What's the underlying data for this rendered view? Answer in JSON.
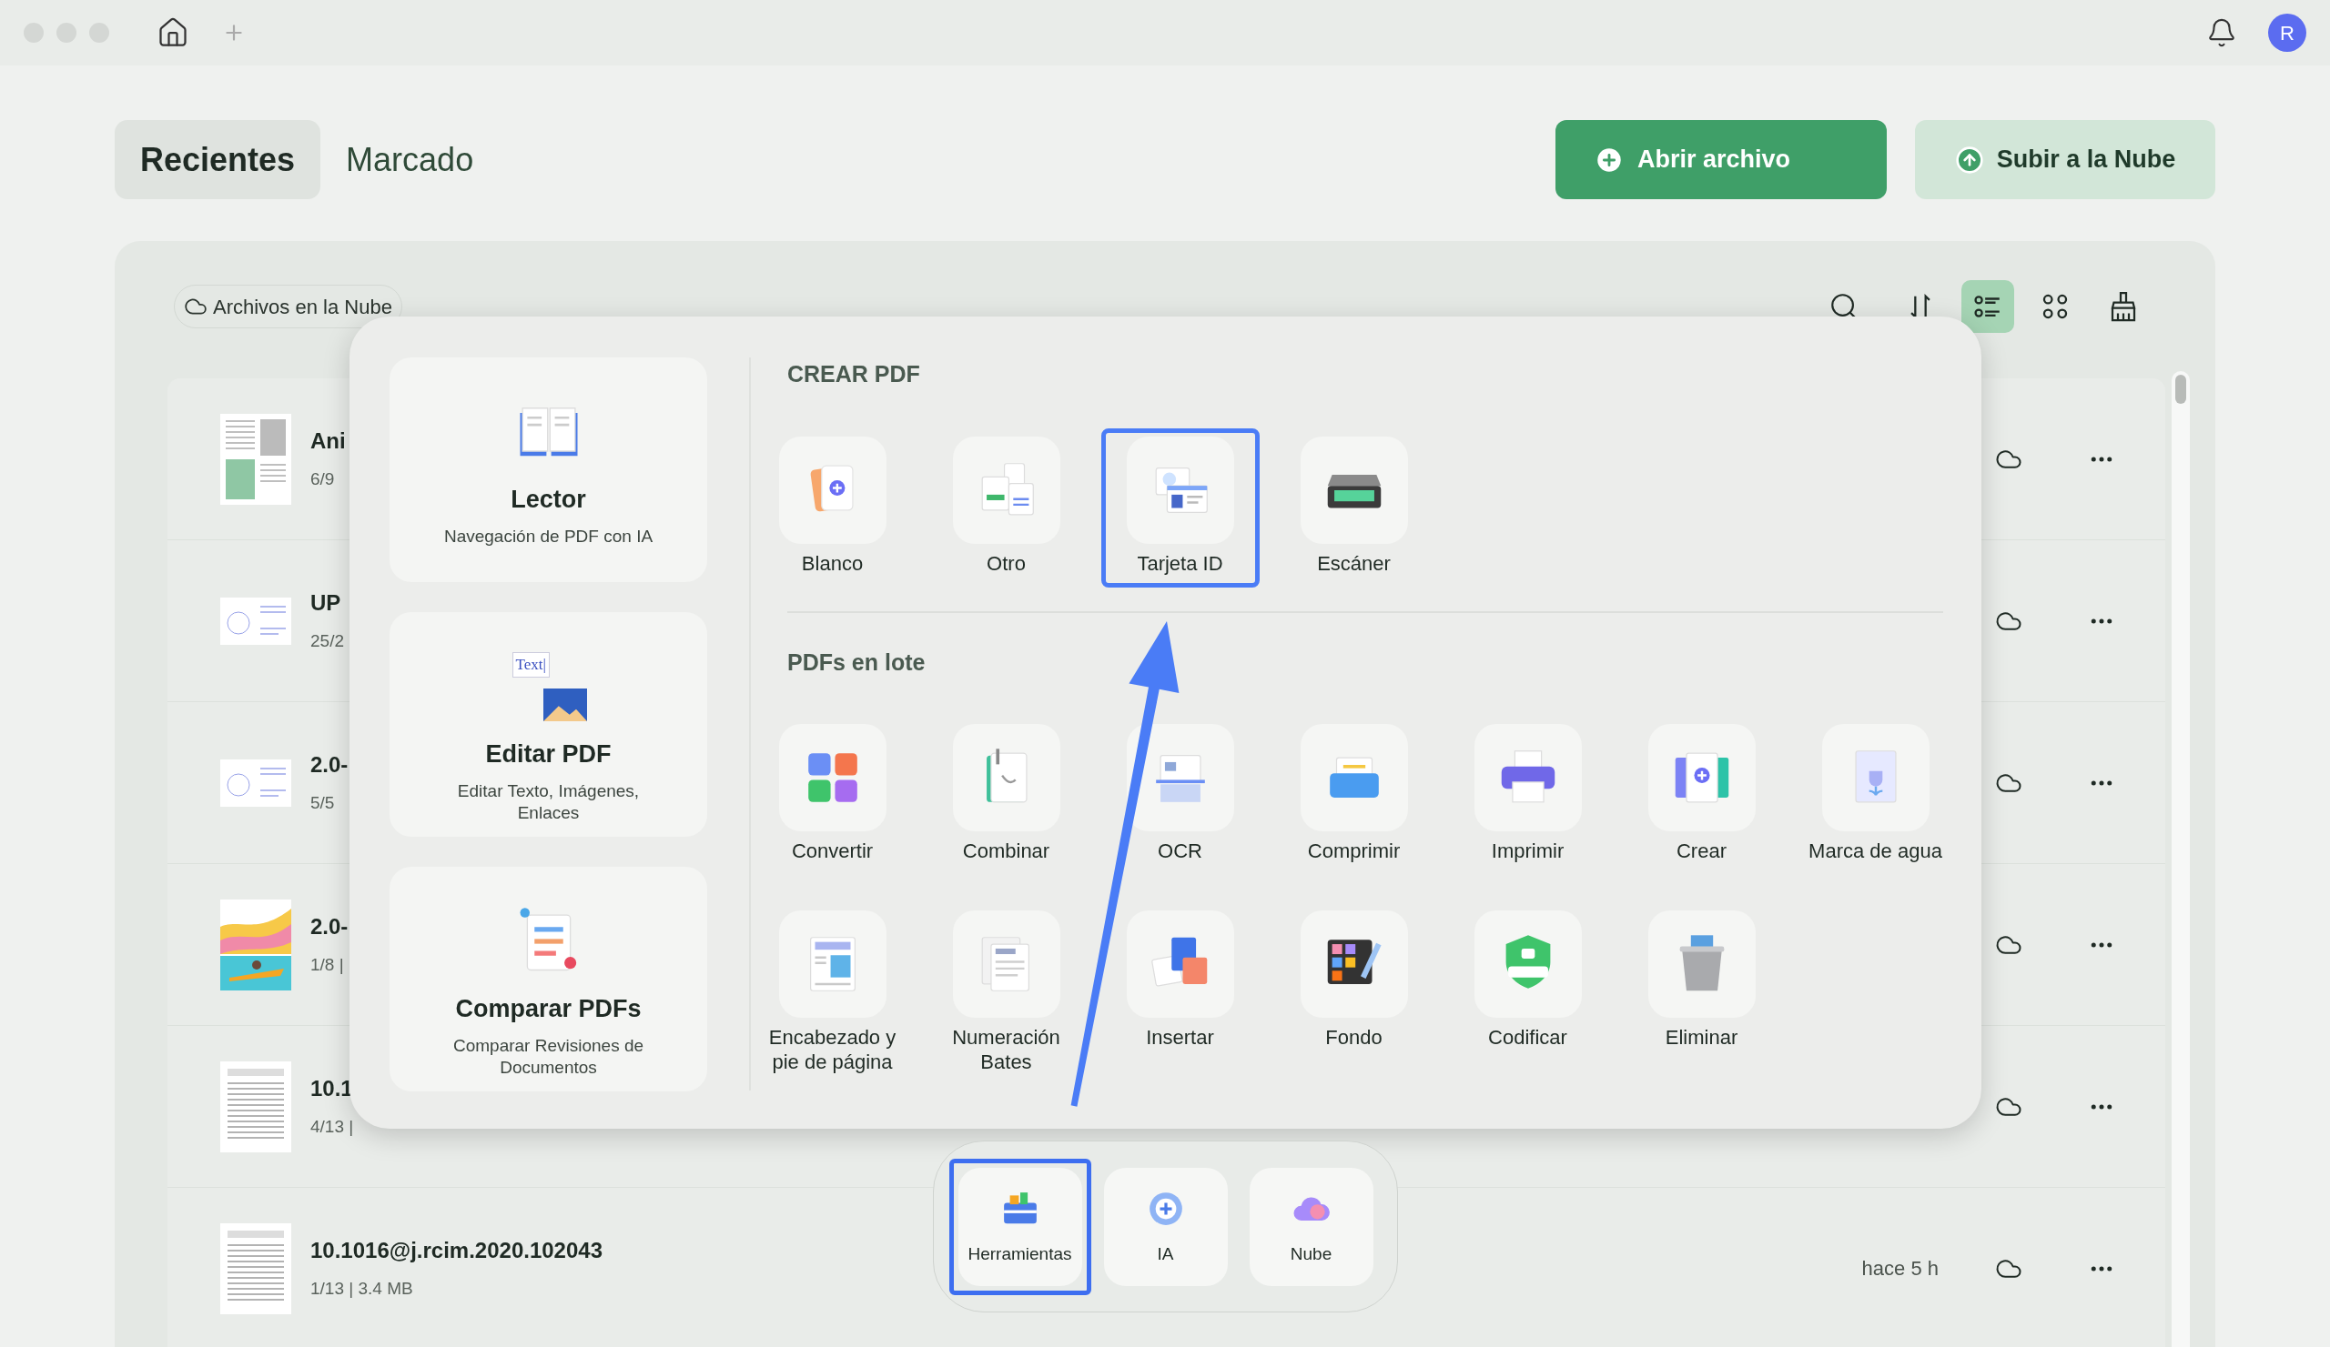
{
  "titlebar": {
    "avatar": "R"
  },
  "tabs": [
    {
      "label": "Recientes",
      "selected": true
    },
    {
      "label": "Marcado",
      "selected": false
    }
  ],
  "actions": [
    {
      "label": "Abrir archivo",
      "kind": "primary"
    },
    {
      "label": "Subir a la Nube",
      "kind": "secondary"
    }
  ],
  "toolbar": {
    "cloud_chip": "Archivos en la Nube",
    "views": [
      {
        "kind": "list",
        "selected": true
      },
      {
        "kind": "grid",
        "selected": false
      }
    ]
  },
  "files": [
    {
      "name": "Ani",
      "meta": "6/9",
      "kind": "document"
    },
    {
      "name": "UP",
      "meta": "25/2",
      "kind": "diagram"
    },
    {
      "name": "2.0-",
      "meta": "5/5",
      "kind": "diagram"
    },
    {
      "name": "2.0-",
      "meta": "1/8 |",
      "kind": "cover"
    },
    {
      "name": "10.1",
      "meta": "4/13 |",
      "kind": "article"
    },
    {
      "name": "10.1016@j.rcim.2020.102043",
      "meta": "1/13 | 3.4 MB",
      "time": "hace 5 h",
      "kind": "article"
    }
  ],
  "popup": {
    "cards": [
      {
        "title": "Lector",
        "subtitle": "Navegación de PDF con IA"
      },
      {
        "title": "Editar PDF",
        "subtitle": "Editar Texto, Imágenes, Enlaces",
        "icon_text": "Text|"
      },
      {
        "title": "Comparar PDFs",
        "subtitle": "Comparar Revisiones de Documentos"
      }
    ],
    "sections": [
      {
        "heading": "CREAR PDF",
        "tools": [
          {
            "label": "Blanco",
            "highlighted": false
          },
          {
            "label": "Otro",
            "highlighted": false
          },
          {
            "label": "Tarjeta ID",
            "highlighted": true
          },
          {
            "label": "Escáner",
            "highlighted": false
          }
        ]
      },
      {
        "heading": "PDFs en lote",
        "tools": [
          {
            "label": "Convertir",
            "highlighted": false
          },
          {
            "label": "Combinar",
            "highlighted": false
          },
          {
            "label": "OCR",
            "highlighted": false
          },
          {
            "label": "Comprimir",
            "highlighted": false
          },
          {
            "label": "Imprimir",
            "highlighted": false
          },
          {
            "label": "Crear",
            "highlighted": false
          },
          {
            "label": "Marca de agua",
            "highlighted": false
          },
          {
            "label": "Encabezado y pie de página",
            "highlighted": false
          },
          {
            "label": "Numeración Bates",
            "highlighted": false
          },
          {
            "label": "Insertar",
            "highlighted": false
          },
          {
            "label": "Fondo",
            "highlighted": false
          },
          {
            "label": "Codificar",
            "highlighted": false
          },
          {
            "label": "Eliminar",
            "highlighted": false
          }
        ]
      }
    ]
  },
  "dock": [
    {
      "label": "Herramientas",
      "highlighted": true
    },
    {
      "label": "IA",
      "highlighted": false
    },
    {
      "label": "Nube",
      "highlighted": false
    }
  ]
}
